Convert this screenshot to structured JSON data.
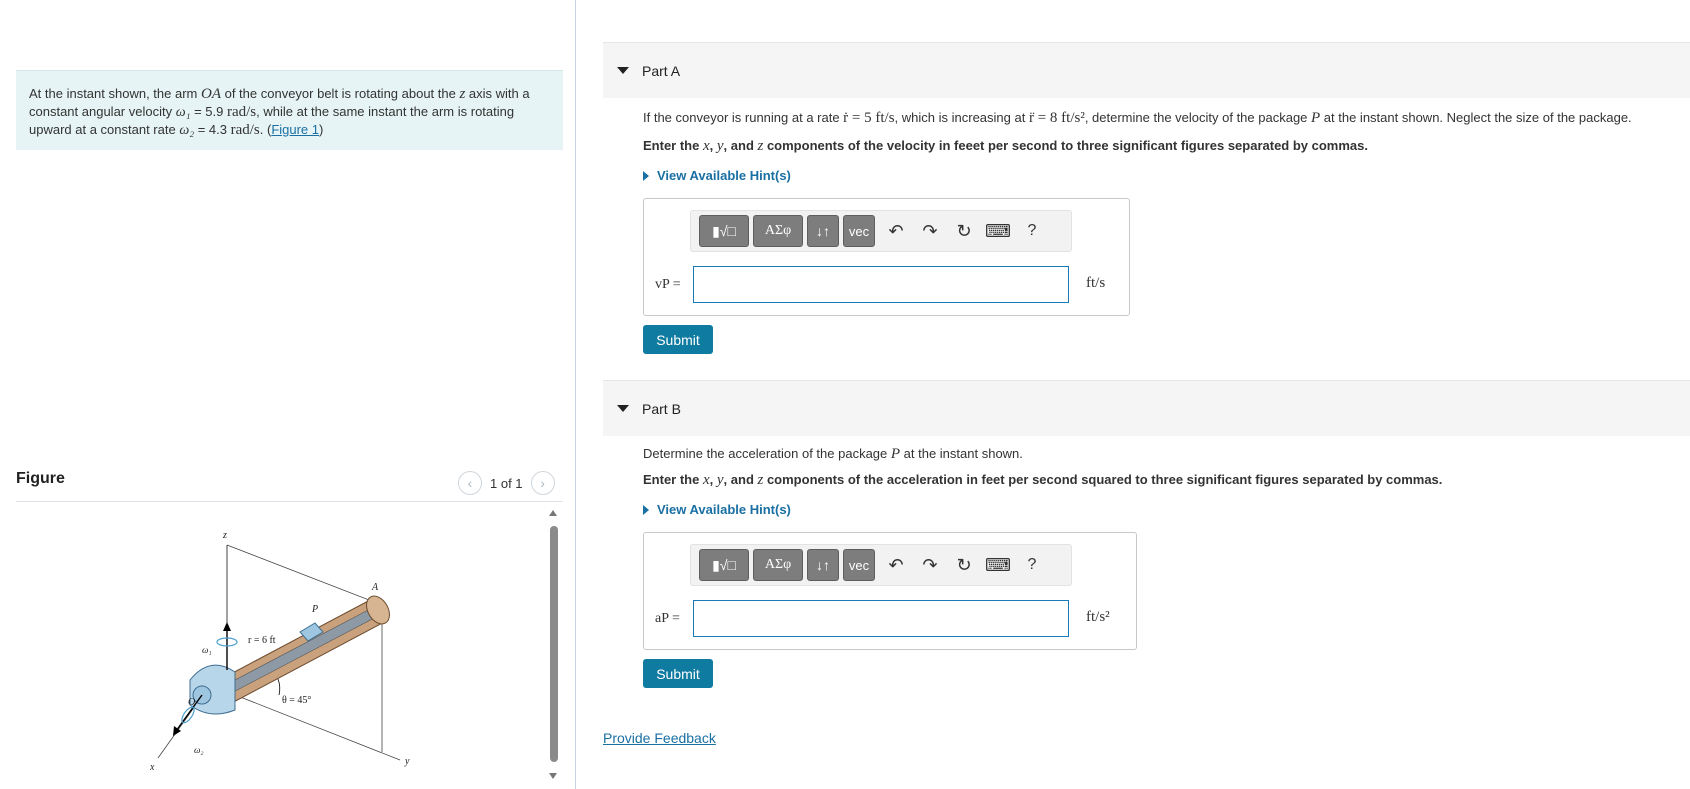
{
  "problem": {
    "text_1": "At the instant shown, the arm ",
    "arm": "OA",
    "text_2": " of the conveyor belt is rotating about the ",
    "axis_z": "z",
    "text_3": " axis with a",
    "line2_1": "constant angular velocity ",
    "omega1_sym": "ω₁",
    "omega1_val": " = 5.9 ",
    "unit_rads": "rad/s",
    "line2_2": ", while at the same instant the arm is rotating",
    "line3_1": "upward at a constant rate ",
    "omega2_sym": "ω₂",
    "omega2_val": " = 4.3 ",
    "line3_2": ". (",
    "figure_link": "Figure 1",
    "line3_3": ")"
  },
  "figure": {
    "title": "Figure",
    "counter": "1 of 1",
    "prev_icon": "chevron-left-icon",
    "next_icon": "chevron-right-icon",
    "labels": {
      "z": "z",
      "x": "x",
      "y": "y",
      "A": "A",
      "P": "P",
      "O": "O",
      "r": "r = 6 ft",
      "theta": "θ = 45°",
      "w1": "ω₁",
      "w2": "ω₂"
    }
  },
  "part_a": {
    "title": "Part A",
    "q_1": "If the conveyor is running at a rate ",
    "rdot": "ṙ = 5 ft/s",
    "q_2": ", which is increasing at ",
    "rddot": "r̈ = 8 ft/s²",
    "q_3": ", determine the velocity of the package ",
    "P": "P",
    "q_4": " at the instant shown. Neglect the size of the package.",
    "instr_1": "Enter the ",
    "x": "x",
    "comma1": ", ",
    "y": "y",
    "and": ", and ",
    "z": "z",
    "instr_2": " components of the velocity in feeet per second to three significant figures separated by commas.",
    "hint": "View Available Hint(s)",
    "var_label": "vP =",
    "unit": "ft/s",
    "submit": "Submit"
  },
  "part_b": {
    "title": "Part B",
    "q_1": "Determine the acceleration of the package ",
    "P": "P",
    "q_2": " at the instant shown.",
    "instr_1": "Enter the ",
    "x": "x",
    "comma1": ", ",
    "y": "y",
    "and": ", and ",
    "z": "z",
    "instr_2": " components of the acceleration in feet per second squared to three significant figures separated by commas.",
    "hint": "View Available Hint(s)",
    "var_label": "aP =",
    "unit": "ft/s²",
    "submit": "Submit"
  },
  "toolbar": {
    "template_btn": "▮√□",
    "greek_btn": "ΑΣφ",
    "updown_btn": "↓↑",
    "vec_btn": "vec",
    "undo_icon": "↶",
    "redo_icon": "↷",
    "reset_icon": "↻",
    "keyboard_icon": "⌨",
    "help": "?"
  },
  "feedback": "Provide Feedback",
  "colors": {
    "link": "#1a6fa3",
    "submit": "#0f7ba0",
    "problem_bg": "#e6f4f5",
    "toolbar_btn": "#7d7d7d"
  }
}
